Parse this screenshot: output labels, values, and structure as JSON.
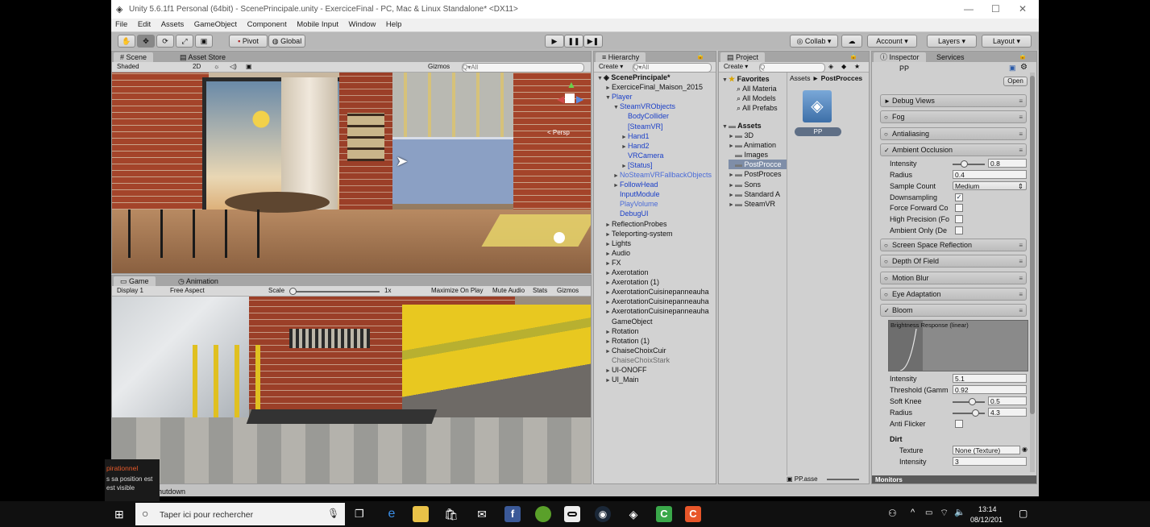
{
  "window": {
    "title": "Unity 5.6.1f1 Personal (64bit) - ScenePrincipale.unity - ExerciceFinal - PC, Mac & Linux Standalone* <DX11>"
  },
  "menu": [
    "File",
    "Edit",
    "Assets",
    "GameObject",
    "Component",
    "Mobile Input",
    "Window",
    "Help"
  ],
  "toolbar": {
    "pivot": "Pivot",
    "global": "Global",
    "collab": "Collab",
    "account": "Account",
    "layers": "Layers",
    "layout": "Layout"
  },
  "scene": {
    "tab_scene": "Scene",
    "tab_store": "Asset Store",
    "shaded": "Shaded",
    "mode_2d": "2D",
    "gizmos": "Gizmos",
    "search": "All",
    "persp": "< Persp"
  },
  "game": {
    "tab_game": "Game",
    "tab_animation": "Animation",
    "display": "Display 1",
    "aspect": "Free Aspect",
    "scale_label": "Scale",
    "scale_value": "1x",
    "maximize": "Maximize On Play",
    "mute": "Mute Audio",
    "stats": "Stats",
    "gizmos": "Gizmos"
  },
  "hierarchy": {
    "tab": "Hierarchy",
    "create": "Create",
    "search": "All",
    "rows": [
      {
        "label": "ScenePrincipale*",
        "indent": 0,
        "arrow": "▼",
        "style": "bold"
      },
      {
        "label": "ExerciceFinal_Maison_2015",
        "indent": 1,
        "arrow": "►",
        "style": ""
      },
      {
        "label": "Player",
        "indent": 1,
        "arrow": "▼",
        "style": "blue"
      },
      {
        "label": "SteamVRObjects",
        "indent": 2,
        "arrow": "▼",
        "style": "blue"
      },
      {
        "label": "BodyCollider",
        "indent": 3,
        "arrow": "",
        "style": "blue"
      },
      {
        "label": "[SteamVR]",
        "indent": 3,
        "arrow": "",
        "style": "blue"
      },
      {
        "label": "Hand1",
        "indent": 3,
        "arrow": "►",
        "style": "blue"
      },
      {
        "label": "Hand2",
        "indent": 3,
        "arrow": "►",
        "style": "blue"
      },
      {
        "label": "VRCamera",
        "indent": 3,
        "arrow": "",
        "style": "blue"
      },
      {
        "label": "[Status]",
        "indent": 3,
        "arrow": "►",
        "style": "blue"
      },
      {
        "label": "NoSteamVRFallbackObjects",
        "indent": 2,
        "arrow": "►",
        "style": "lblue"
      },
      {
        "label": "FollowHead",
        "indent": 2,
        "arrow": "►",
        "style": "blue"
      },
      {
        "label": "InputModule",
        "indent": 2,
        "arrow": "",
        "style": "blue"
      },
      {
        "label": "PlayVolume",
        "indent": 2,
        "arrow": "",
        "style": "lblue"
      },
      {
        "label": "DebugUI",
        "indent": 2,
        "arrow": "",
        "style": "blue"
      },
      {
        "label": "ReflectionProbes",
        "indent": 1,
        "arrow": "►",
        "style": ""
      },
      {
        "label": "Teleporting-system",
        "indent": 1,
        "arrow": "►",
        "style": ""
      },
      {
        "label": "Lights",
        "indent": 1,
        "arrow": "►",
        "style": ""
      },
      {
        "label": "Audio",
        "indent": 1,
        "arrow": "►",
        "style": ""
      },
      {
        "label": "FX",
        "indent": 1,
        "arrow": "►",
        "style": ""
      },
      {
        "label": "Axerotation",
        "indent": 1,
        "arrow": "►",
        "style": ""
      },
      {
        "label": "Axerotation (1)",
        "indent": 1,
        "arrow": "►",
        "style": ""
      },
      {
        "label": "AxerotationCuisinepanneauha",
        "indent": 1,
        "arrow": "►",
        "style": ""
      },
      {
        "label": "AxerotationCuisinepanneauha",
        "indent": 1,
        "arrow": "►",
        "style": ""
      },
      {
        "label": "AxerotationCuisinepanneauha",
        "indent": 1,
        "arrow": "►",
        "style": ""
      },
      {
        "label": "GameObject",
        "indent": 1,
        "arrow": "",
        "style": ""
      },
      {
        "label": "Rotation",
        "indent": 1,
        "arrow": "►",
        "style": ""
      },
      {
        "label": "Rotation (1)",
        "indent": 1,
        "arrow": "►",
        "style": ""
      },
      {
        "label": "ChaiseChoixCuir",
        "indent": 1,
        "arrow": "►",
        "style": ""
      },
      {
        "label": "ChaiseChoixStark",
        "indent": 1,
        "arrow": "",
        "style": "grey"
      },
      {
        "label": "UI-ONOFF",
        "indent": 1,
        "arrow": "►",
        "style": ""
      },
      {
        "label": "UI_Main",
        "indent": 1,
        "arrow": "►",
        "style": ""
      }
    ]
  },
  "project": {
    "tab": "Project",
    "create": "Create",
    "breadcrumb_root": "Assets",
    "breadcrumb_current": "PostProcces",
    "favorites": "Favorites",
    "fav_items": [
      "All Materia",
      "All Models",
      "All Prefabs"
    ],
    "assets": "Assets",
    "asset_items": [
      "3D",
      "Animation",
      "Images",
      "PostProcce",
      "PostProces",
      "Sons",
      "Standard A",
      "SteamVR"
    ],
    "file_name": "PP",
    "footer": "PP.asse"
  },
  "inspector": {
    "tab": "Inspector",
    "tab_services": "Services",
    "object": "PP",
    "open": "Open",
    "sections": {
      "debug": "Debug Views",
      "fog": "Fog",
      "aa": "Antialiasing",
      "ao": "Ambient Occlusion",
      "ssr": "Screen Space Reflection",
      "dof": "Depth Of Field",
      "mb": "Motion Blur",
      "eye": "Eye Adaptation",
      "bloom": "Bloom"
    },
    "ao": {
      "intensity_label": "Intensity",
      "intensity": "0.8",
      "radius_label": "Radius",
      "radius": "0.4",
      "sample_label": "Sample Count",
      "sample": "Medium",
      "down_label": "Downsampling",
      "ff_label": "Force Forward Co",
      "hp_label": "High Precision (Fo",
      "ambient_label": "Ambient Only (De"
    },
    "bloom": {
      "curve_label": "Brightness Response (linear)",
      "intensity_label": "Intensity",
      "intensity": "5.1",
      "threshold_label": "Threshold (Gamm",
      "threshold": "0.92",
      "knee_label": "Soft Knee",
      "knee": "0.5",
      "radius_label": "Radius",
      "radius": "4.3",
      "flicker_label": "Anti Flicker",
      "dirt": "Dirt",
      "texture_label": "Texture",
      "texture": "None (Texture)",
      "dirt_int_label": "Intensity",
      "dirt_int": "3"
    },
    "monitors": "Monitors"
  },
  "status": {
    "text": "hutdown"
  },
  "overlay": {
    "line1": "pirationnel",
    "line2": "s sa position est",
    "line3": "est visible"
  },
  "taskbar": {
    "search": "Taper ici pour rechercher",
    "time": "13:14",
    "date": "08/12/201"
  }
}
